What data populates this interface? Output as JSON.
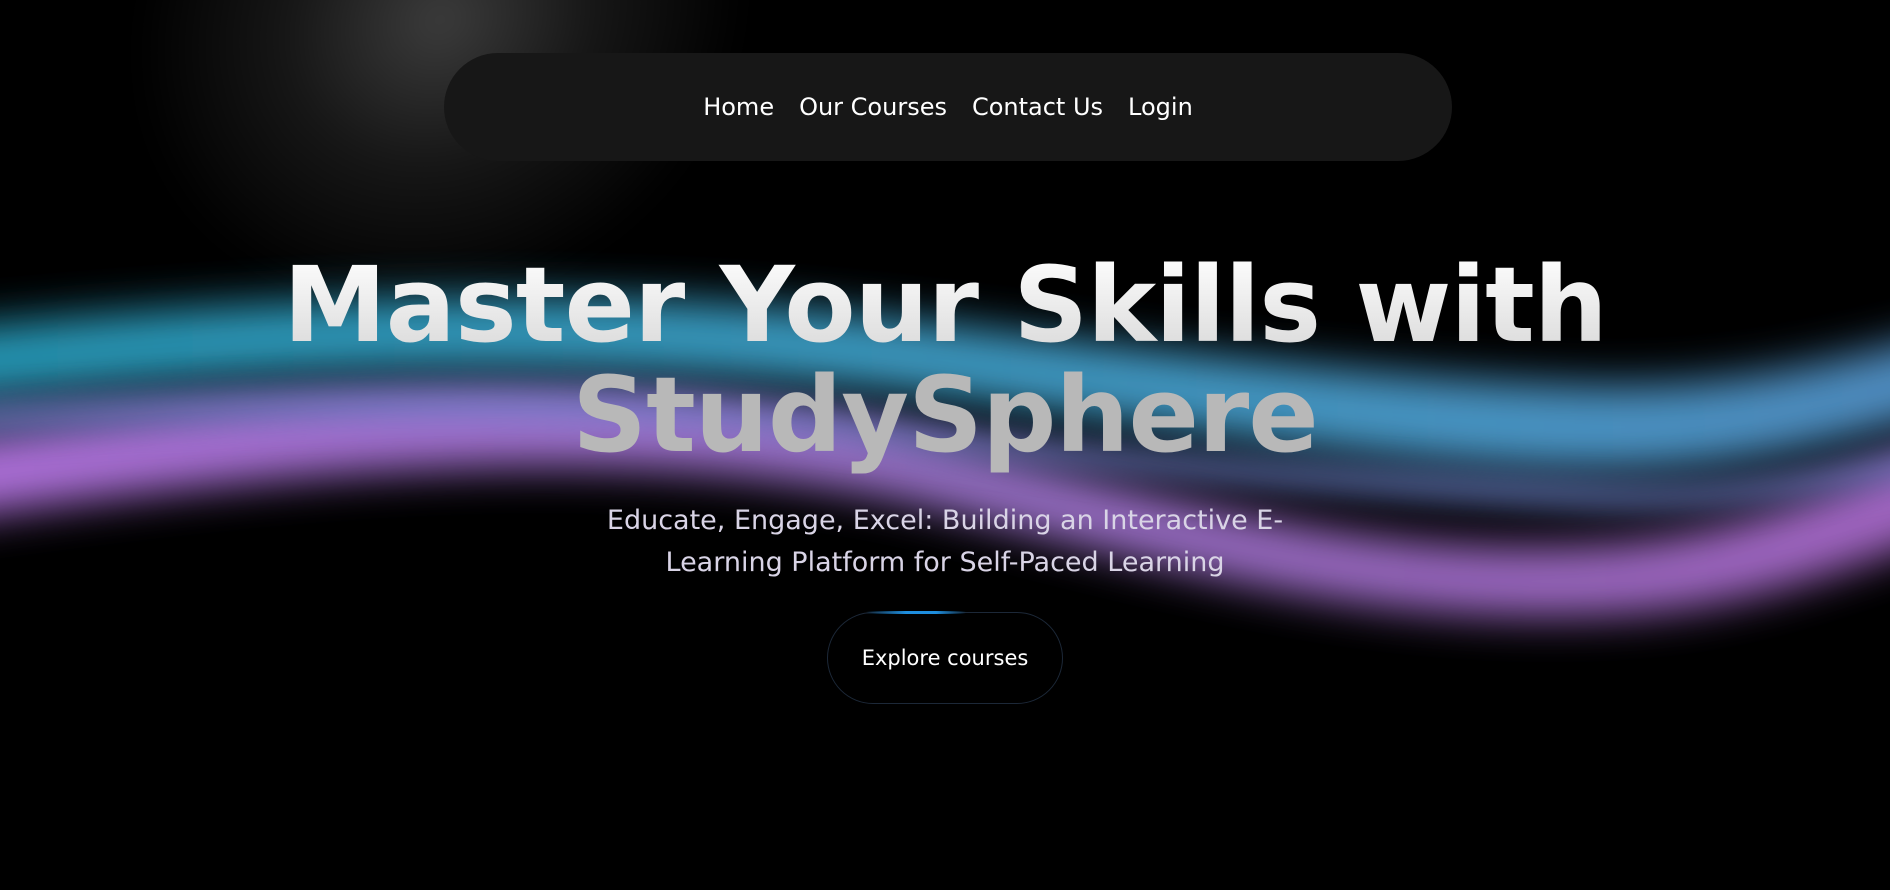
{
  "nav": {
    "items": [
      {
        "label": "Home"
      },
      {
        "label": "Our Courses"
      },
      {
        "label": "Contact Us"
      },
      {
        "label": "Login"
      }
    ]
  },
  "hero": {
    "headline_line1": "Master Your Skills with",
    "headline_line2": "StudySphere",
    "subtitle": "Educate, Engage, Excel: Building an Interactive E-Learning Platform for Self-Paced Learning",
    "cta_label": "Explore courses"
  },
  "colors": {
    "background": "#000000",
    "nav_background": "#171717",
    "wave_cyan": "#3ab6e0",
    "wave_purple": "#b77ee8",
    "cta_accent": "#1e8ede"
  }
}
